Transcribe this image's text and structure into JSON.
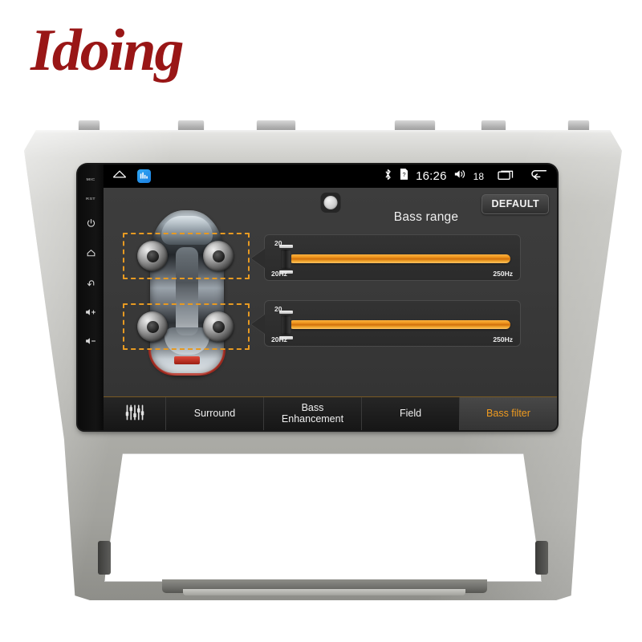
{
  "brand": {
    "logo_text": "Idoing"
  },
  "device": {
    "hardware_buttons": [
      {
        "name": "mic",
        "label": "MIC",
        "type": "text"
      },
      {
        "name": "reset",
        "label": "RST",
        "type": "text"
      },
      {
        "name": "power",
        "label": "",
        "type": "icon",
        "icon": "power-icon"
      },
      {
        "name": "home",
        "label": "",
        "type": "icon",
        "icon": "home-icon"
      },
      {
        "name": "back",
        "label": "",
        "type": "icon",
        "icon": "back-arrow-icon"
      },
      {
        "name": "volume-up",
        "label": "",
        "type": "icon",
        "icon": "volume-up-icon"
      },
      {
        "name": "volume-down",
        "label": "",
        "type": "icon",
        "icon": "volume-down-icon"
      }
    ]
  },
  "statusbar": {
    "home_icon": "home-icon",
    "app_icon": "equalizer-app-icon",
    "bluetooth_icon": "bluetooth-icon",
    "sd_icon": "sd-card-icon",
    "clock": "16:26",
    "volume_icon": "volume-icon",
    "volume_level": "18",
    "recents_icon": "recents-icon",
    "back_icon": "back-arrow-icon"
  },
  "app": {
    "panel_title": "Bass range",
    "default_button": "DEFAULT",
    "sensor_button": "sensor-knob",
    "car_diagram": {
      "name": "car-speaker-layout",
      "speakers": [
        "front-left",
        "front-right",
        "rear-left",
        "rear-right"
      ],
      "selection_boxes": [
        "front-pair",
        "rear-pair"
      ],
      "selection_color": "#e79a22"
    },
    "sliders": [
      {
        "name": "front-bass-range-slider",
        "value": "20",
        "min_label": "20Hz",
        "max_label": "250Hz",
        "fill_pct": 100,
        "thumb_pct": 0
      },
      {
        "name": "rear-bass-range-slider",
        "value": "20",
        "min_label": "20Hz",
        "max_label": "250Hz",
        "fill_pct": 100,
        "thumb_pct": 0
      }
    ],
    "tabs": [
      {
        "name": "equalizer",
        "label": "",
        "icon": "equalizer-sliders-icon",
        "active": false
      },
      {
        "name": "surround",
        "label": "Surround",
        "active": false
      },
      {
        "name": "bass-enhancement",
        "label": "Bass\nEnhancement",
        "line1": "Bass",
        "line2": "Enhancement",
        "active": false
      },
      {
        "name": "field",
        "label": "Field",
        "active": false
      },
      {
        "name": "bass-filter",
        "label": "Bass filter",
        "active": true
      }
    ],
    "colors": {
      "accent_orange": "#ef9b20",
      "slider_orange": "#f19a20",
      "dashed_box": "#e79a22",
      "screen_bg": "#3a3a3a",
      "statusbar_bg": "#000000"
    }
  }
}
